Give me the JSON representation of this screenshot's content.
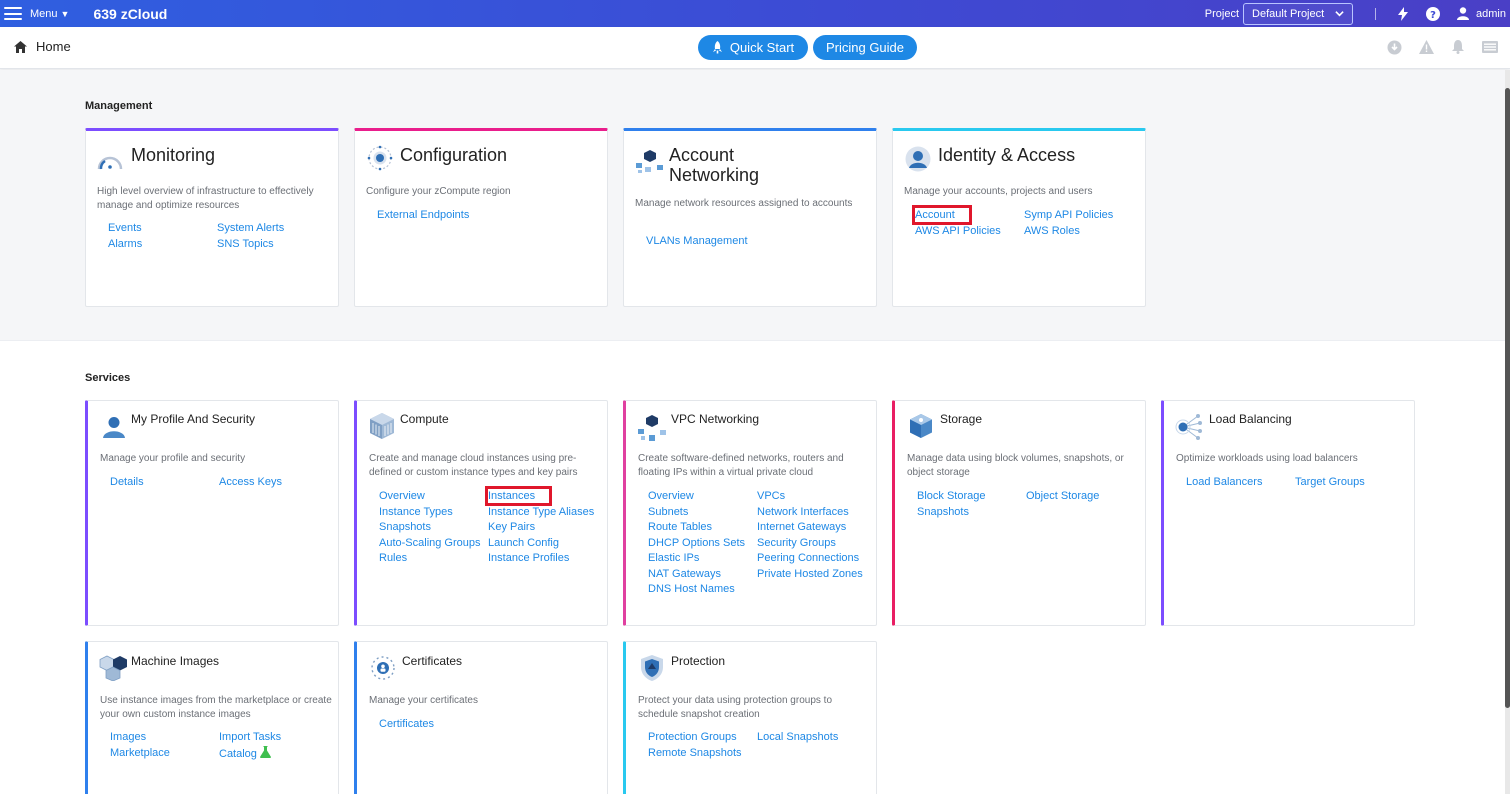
{
  "topbar": {
    "menu_label": "Menu",
    "brand": "639 zCloud",
    "project_label": "Project",
    "project_value": "Default Project",
    "user": "admin"
  },
  "subbar": {
    "home": "Home",
    "quick_start": "Quick Start",
    "pricing_guide": "Pricing Guide"
  },
  "management": {
    "title": "Management",
    "cards": [
      {
        "title": "Monitoring",
        "desc": "High level overview of infrastructure to effectively manage and optimize resources",
        "color": "#7c4dff",
        "links": [
          "Events",
          "System Alerts",
          "Alarms",
          "SNS Topics"
        ]
      },
      {
        "title": "Configuration",
        "desc": "Configure your zCompute region",
        "color": "#e91e8c",
        "links": [
          "External Endpoints"
        ]
      },
      {
        "title": "Account Networking",
        "title_line1": "Account",
        "title_line2": "Networking",
        "desc": "Manage network resources assigned to accounts",
        "color": "#2f80ed",
        "links": [
          "VLANs Management"
        ]
      },
      {
        "title": "Identity & Access",
        "desc": "Manage your accounts, projects and users",
        "color": "#29c9ef",
        "links": [
          "Account",
          "Symp API Policies",
          "AWS API Policies",
          "AWS Roles"
        ]
      }
    ]
  },
  "services": {
    "title": "Services",
    "cards": [
      {
        "title": "My Profile And Security",
        "desc": "Manage your profile and security",
        "color": "#7c4dff",
        "links": [
          "Details",
          "Access Keys"
        ]
      },
      {
        "title": "Compute",
        "desc": "Create and manage cloud instances using pre-defined or custom instance types and key pairs",
        "color": "#7c4dff",
        "links": [
          "Overview",
          "Instances",
          "Instance Types",
          "Instance Type Aliases",
          "Snapshots",
          "Key Pairs",
          "Auto-Scaling Groups",
          "Launch Config",
          "Rules",
          "Instance Profiles"
        ]
      },
      {
        "title": "VPC Networking",
        "desc": "Create software-defined networks, routers and floating IPs within a virtual private cloud",
        "color": "#e040a0",
        "links": [
          "Overview",
          "VPCs",
          "Subnets",
          "Network Interfaces",
          "Route Tables",
          "Internet Gateways",
          "DHCP Options Sets",
          "Security Groups",
          "Elastic IPs",
          "Peering Connections",
          "NAT Gateways",
          "Private Hosted Zones",
          "DNS Host Names"
        ]
      },
      {
        "title": "Storage",
        "desc": "Manage data using block volumes, snapshots, or object storage",
        "color": "#e91e63",
        "links": [
          "Block Storage",
          "Object Storage",
          "Snapshots"
        ]
      },
      {
        "title": "Load Balancing",
        "desc": "Optimize workloads using load balancers",
        "color": "#7c4dff",
        "links": [
          "Load Balancers",
          "Target Groups"
        ]
      },
      {
        "title": "Machine Images",
        "desc": "Use instance images from the marketplace or create your own custom instance images",
        "color": "#2f80ed",
        "links": [
          "Images",
          "Import Tasks",
          "Marketplace",
          "Catalog"
        ]
      },
      {
        "title": "Certificates",
        "desc": "Manage your certificates",
        "color": "#2f80ed",
        "links": [
          "Certificates"
        ]
      },
      {
        "title": "Protection",
        "desc": "Protect your data using protection groups to schedule snapshot creation",
        "color": "#29c9ef",
        "links": [
          "Protection Groups",
          "Local Snapshots",
          "Remote Snapshots"
        ]
      }
    ]
  }
}
